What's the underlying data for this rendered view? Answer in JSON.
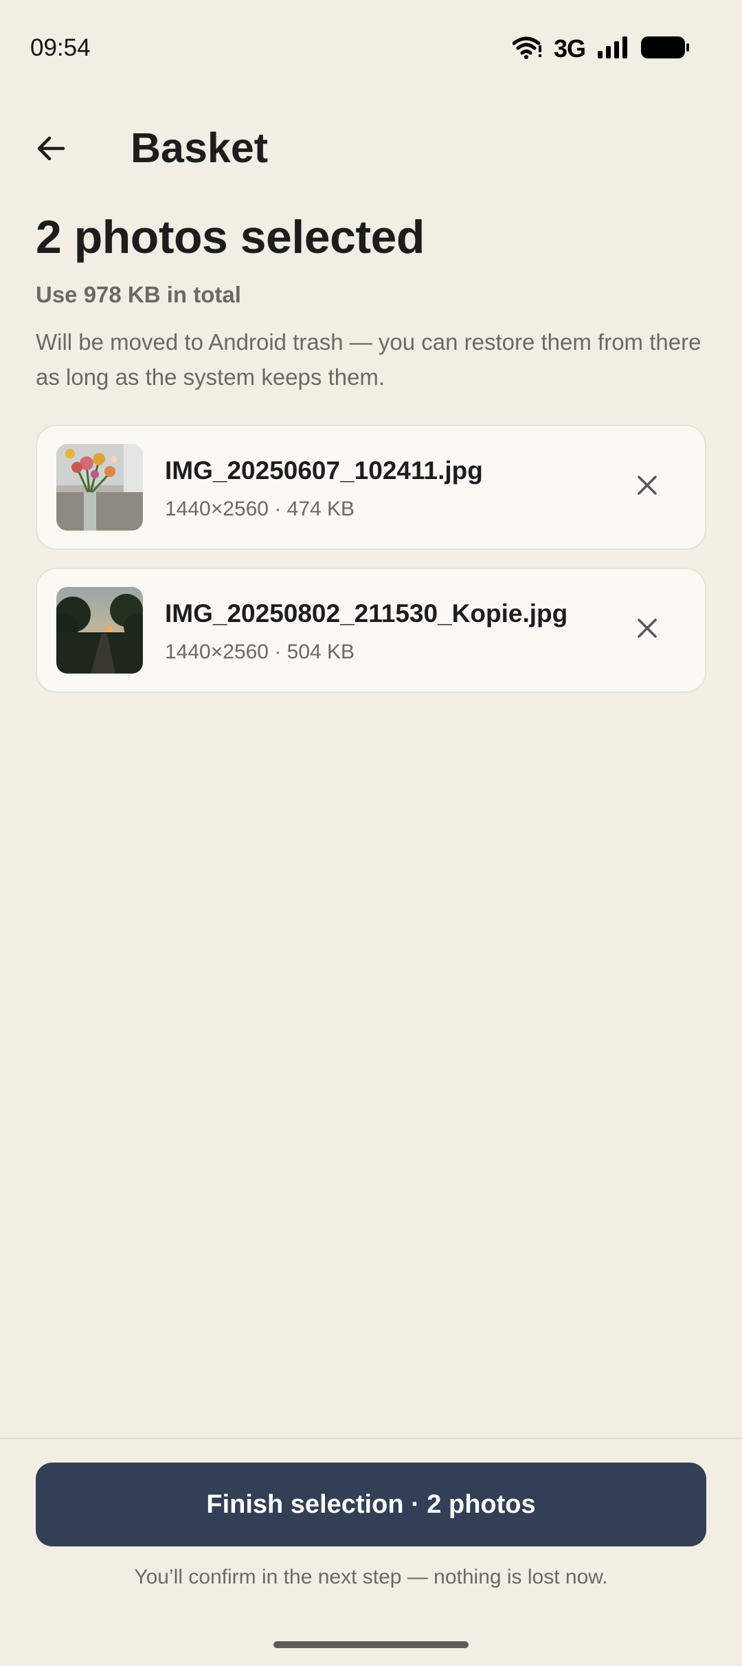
{
  "status_bar": {
    "time": "09:54",
    "network_label": "3G",
    "icons": [
      "wifi-icon",
      "signal-icon",
      "battery-icon"
    ]
  },
  "app_bar": {
    "title": "Basket",
    "back_icon": "arrow-left-icon"
  },
  "selection": {
    "headline": "2 photos selected",
    "summary": "Use 978 KB in total",
    "description": "Will be moved to Android trash — you can restore them from there as long as the system keeps them."
  },
  "photos": [
    {
      "name": "IMG_20250607_102411.jpg",
      "meta": "1440×2560 · 474 KB",
      "thumbnail": "flowers-vase-photo",
      "remove_icon": "close-icon"
    },
    {
      "name": "IMG_20250802_211530_Kopie.jpg",
      "meta": "1440×2560 · 504 KB",
      "thumbnail": "sunset-path-photo",
      "remove_icon": "close-icon"
    }
  ],
  "footer": {
    "finish_label": "Finish selection · 2 photos",
    "footnote": "You’ll confirm in the next step — nothing is lost now."
  },
  "colors": {
    "background": "#f2eee4",
    "card": "#fbf9f3",
    "primary_button": "#323f54",
    "muted_text": "#6b6964"
  }
}
